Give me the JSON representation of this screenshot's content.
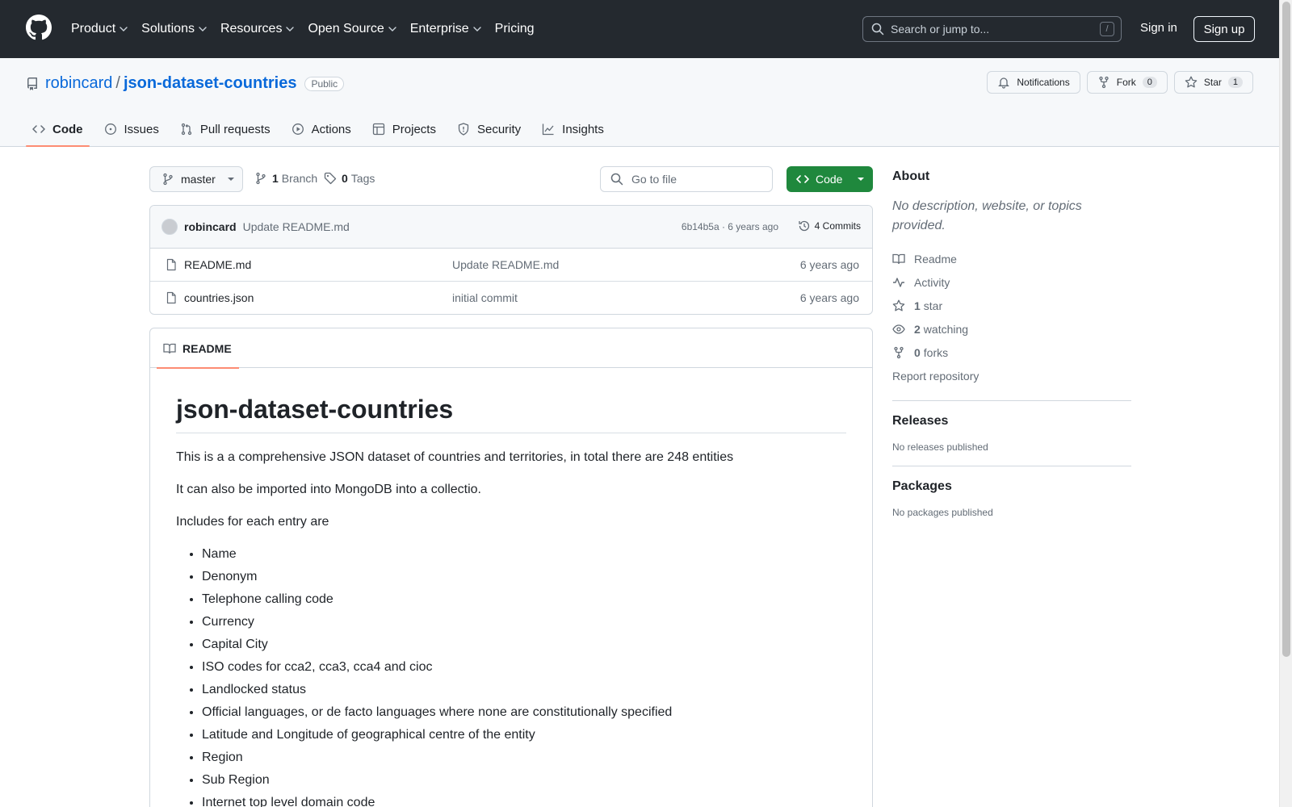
{
  "header": {
    "nav": [
      {
        "label": "Product",
        "has_menu": true
      },
      {
        "label": "Solutions",
        "has_menu": true
      },
      {
        "label": "Resources",
        "has_menu": true
      },
      {
        "label": "Open Source",
        "has_menu": true
      },
      {
        "label": "Enterprise",
        "has_menu": true
      },
      {
        "label": "Pricing",
        "has_menu": false
      }
    ],
    "search_placeholder": "Search or jump to...",
    "search_shortcut": "/",
    "sign_in": "Sign in",
    "sign_up": "Sign up"
  },
  "repo": {
    "owner": "robincard",
    "separator": "/",
    "name": "json-dataset-countries",
    "visibility": "Public",
    "actions": {
      "notifications": "Notifications",
      "fork": "Fork",
      "fork_count": "0",
      "star": "Star",
      "star_count": "1"
    },
    "tabs": [
      {
        "label": "Code",
        "icon": "code-icon",
        "active": true
      },
      {
        "label": "Issues",
        "icon": "issue-icon",
        "active": false
      },
      {
        "label": "Pull requests",
        "icon": "pull-request-icon",
        "active": false
      },
      {
        "label": "Actions",
        "icon": "play-icon",
        "active": false
      },
      {
        "label": "Projects",
        "icon": "table-icon",
        "active": false
      },
      {
        "label": "Security",
        "icon": "shield-icon",
        "active": false
      },
      {
        "label": "Insights",
        "icon": "graph-icon",
        "active": false
      }
    ]
  },
  "toolbar": {
    "branch": "master",
    "branch_count": "1",
    "branch_label": "Branch",
    "tag_count": "0",
    "tag_label": "Tags",
    "goto_placeholder": "Go to file",
    "code_button": "Code"
  },
  "commit": {
    "author": "robincard",
    "message": "Update README.md",
    "meta": "6b14b5a · 6 years ago",
    "commits": "4 Commits"
  },
  "files": [
    {
      "name": "README.md",
      "message": "Update README.md",
      "date": "6 years ago"
    },
    {
      "name": "countries.json",
      "message": "initial commit",
      "date": "6 years ago"
    }
  ],
  "readme": {
    "tab": "README",
    "title": "json-dataset-countries",
    "paragraphs": [
      "This is a a comprehensive JSON dataset of countries and territories, in total there are 248 entities",
      "It can also be imported into MongoDB into a collectio.",
      "Includes for each entry are"
    ],
    "items": [
      "Name",
      "Denonym",
      "Telephone calling code",
      "Currency",
      "Capital City",
      "ISO codes for cca2, cca3, cca4 and cioc",
      "Landlocked status",
      "Official languages, or de facto languages where none are constitutionally specified",
      "Latitude and Longitude of geographical centre of the entity",
      "Region",
      "Sub Region",
      "Internet top level domain code"
    ]
  },
  "sidebar": {
    "about_title": "About",
    "about_desc": "No description, website, or topics provided.",
    "readme": "Readme",
    "activity": "Activity",
    "stars_count": "1",
    "stars_label": "star",
    "watching_count": "2",
    "watching_label": "watching",
    "forks_count": "0",
    "forks_label": "forks",
    "report": "Report repository",
    "releases_title": "Releases",
    "releases_empty": "No releases published",
    "packages_title": "Packages",
    "packages_empty": "No packages published"
  },
  "colors": {
    "header_bg": "#24292f",
    "link": "#0969da",
    "code_button": "#1f883d",
    "active_tab_underline": "#fd8c73"
  }
}
